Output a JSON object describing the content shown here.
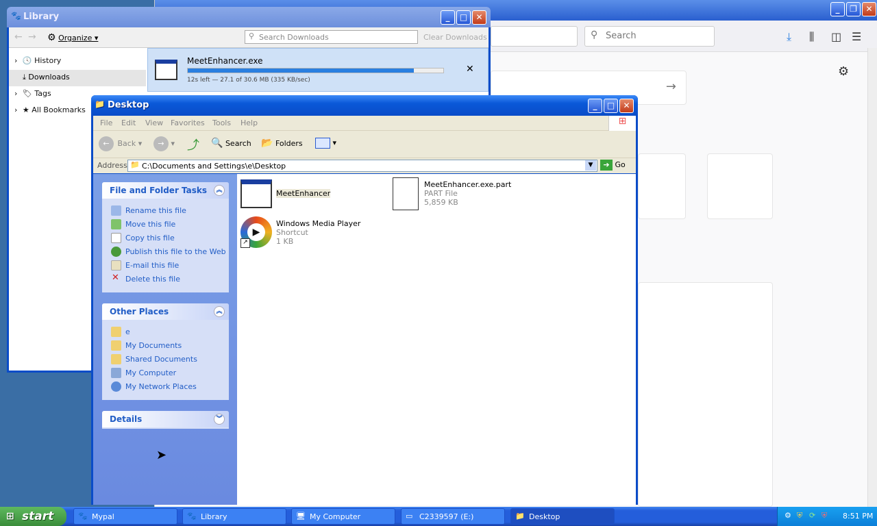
{
  "browser": {
    "search_placeholder": "Search",
    "window_controls": [
      "minimize",
      "restore",
      "close"
    ]
  },
  "library": {
    "title": "Library",
    "organize_label": "Organize ▾",
    "search_placeholder": "Search Downloads",
    "clear_label": "Clear Downloads",
    "sidebar": [
      {
        "label": "History"
      },
      {
        "label": "Downloads"
      },
      {
        "label": "Tags"
      },
      {
        "label": "All Bookmarks"
      }
    ],
    "download": {
      "name": "MeetEnhancer.exe",
      "status": "12s left — 27.1 of 30.6 MB (335 KB/sec)",
      "progress": 0.886
    }
  },
  "explorer": {
    "title": "Desktop",
    "menu": [
      "File",
      "Edit",
      "View",
      "Favorites",
      "Tools",
      "Help"
    ],
    "toolbar": {
      "back": "Back",
      "search": "Search",
      "folders": "Folders"
    },
    "address_label": "Address",
    "address_value": "C:\\Documents and Settings\\e\\Desktop",
    "go_label": "Go",
    "file_tasks": {
      "heading": "File and Folder Tasks",
      "items": [
        "Rename this file",
        "Move this file",
        "Copy this file",
        "Publish this file to the Web",
        "E-mail this file",
        "Delete this file"
      ]
    },
    "other_places": {
      "heading": "Other Places",
      "items": [
        "e",
        "My Documents",
        "Shared Documents",
        "My Computer",
        "My Network Places"
      ]
    },
    "details": {
      "heading": "Details"
    },
    "files": [
      {
        "name": "MeetEnhancer"
      },
      {
        "name": "MeetEnhancer.exe.part",
        "type": "PART File",
        "size": "5,859 KB"
      },
      {
        "name": "Windows Media Player",
        "type": "Shortcut",
        "size": "1 KB"
      }
    ]
  },
  "taskbar": {
    "start_label": "start",
    "items": [
      "Mypal",
      "Library",
      "My Computer",
      "C2339597 (E:)",
      "Desktop"
    ],
    "clock": "8:51 PM"
  }
}
